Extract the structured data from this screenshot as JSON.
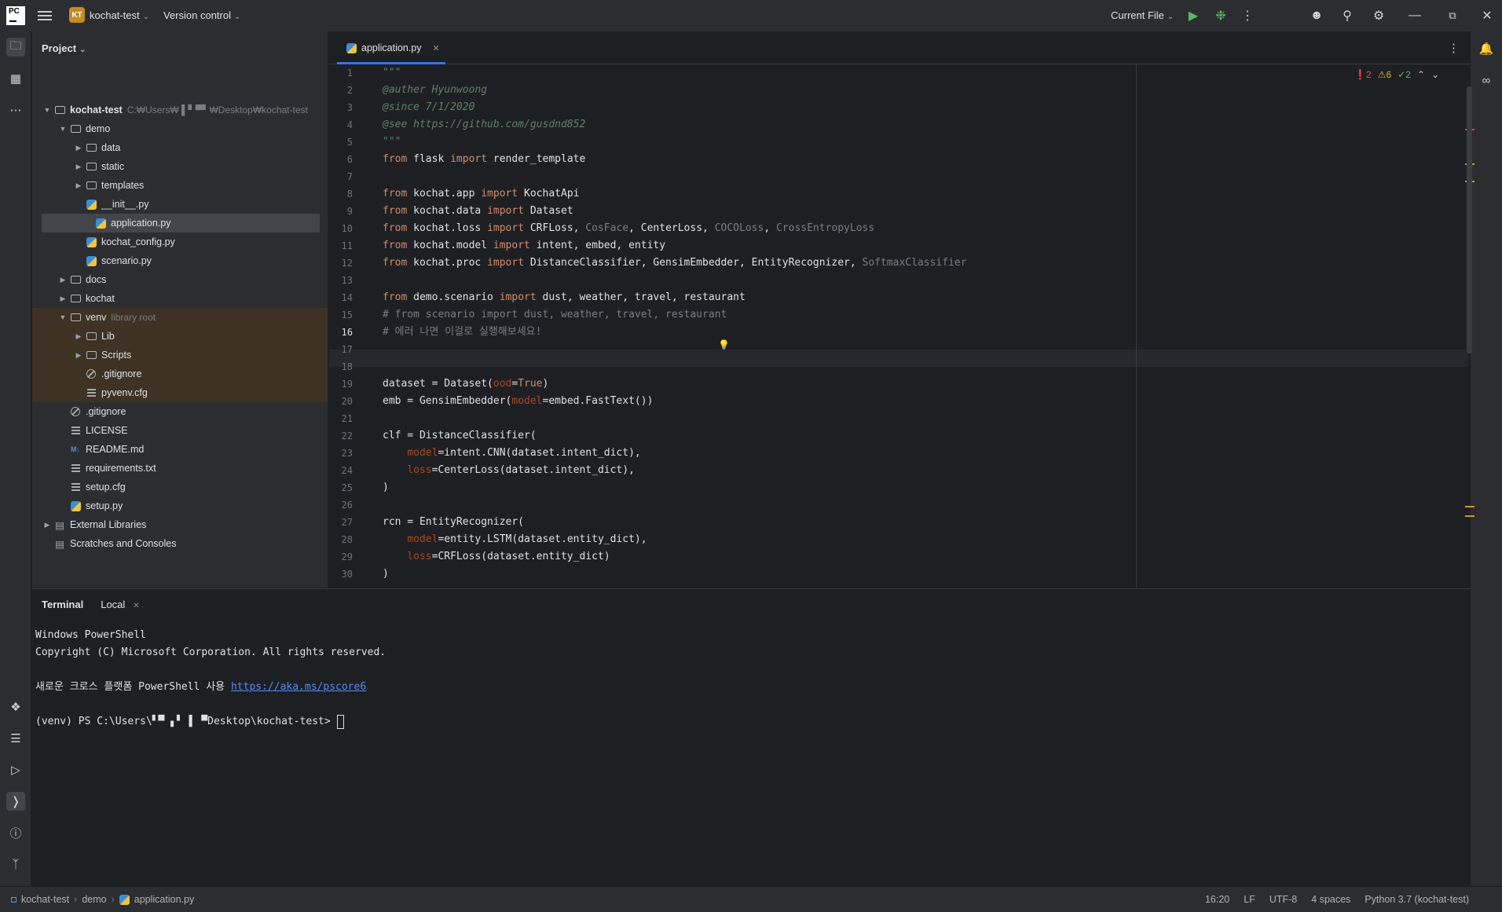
{
  "titlebar": {
    "logo": "PC",
    "project_badge": "KT",
    "project_name": "kochat-test",
    "vcs": "Version control",
    "run_config": "Current File"
  },
  "project_panel": {
    "title": "Project",
    "tree": [
      {
        "label": "kochat-test",
        "suffix": "C:₩Users₩   ▌▘▀▘₩Desktop₩kochat-test"
      },
      {
        "label": "demo"
      },
      {
        "label": "data"
      },
      {
        "label": "static"
      },
      {
        "label": "templates"
      },
      {
        "label": "__init__.py"
      },
      {
        "label": "application.py"
      },
      {
        "label": "kochat_config.py"
      },
      {
        "label": "scenario.py"
      },
      {
        "label": "docs"
      },
      {
        "label": "kochat"
      },
      {
        "label": "venv",
        "suffix": "library root"
      },
      {
        "label": "Lib"
      },
      {
        "label": "Scripts"
      },
      {
        "label": ".gitignore"
      },
      {
        "label": "pyvenv.cfg"
      },
      {
        "label": ".gitignore"
      },
      {
        "label": "LICENSE"
      },
      {
        "label": "README.md",
        "icon_text": "M↓"
      },
      {
        "label": "requirements.txt"
      },
      {
        "label": "setup.cfg"
      },
      {
        "label": "setup.py"
      },
      {
        "label": "External Libraries"
      },
      {
        "label": "Scratches and Consoles"
      }
    ]
  },
  "editor": {
    "tab": "application.py",
    "inspections": {
      "errors": "2",
      "warnings": "6",
      "ok": "2"
    },
    "line_numbers": [
      "1",
      "2",
      "3",
      "4",
      "5",
      "6",
      "7",
      "8",
      "9",
      "10",
      "11",
      "12",
      "13",
      "14",
      "15",
      "16",
      "17",
      "18",
      "19",
      "20",
      "21",
      "22",
      "23",
      "24",
      "25",
      "26",
      "27",
      "28",
      "29",
      "30"
    ],
    "lines": [
      "\"\"\"",
      "@auther Hyunwoong",
      "@since 7/1/2020",
      "@see https://github.com/gusdnd852",
      "\"\"\"",
      "from flask import render_template",
      "",
      "from kochat.app import KochatApi",
      "from kochat.data import Dataset",
      "from kochat.loss import CRFLoss, CosFace, CenterLoss, COCOLoss, CrossEntropyLoss",
      "from kochat.model import intent, embed, entity",
      "from kochat.proc import DistanceClassifier, GensimEmbedder, EntityRecognizer, SoftmaxClassifier",
      "",
      "from demo.scenario import dust, weather, travel, restaurant",
      "# from scenario import dust, weather, travel, restaurant",
      "# 에러 나면 이걸로 실행해보세요!",
      "",
      "",
      "dataset = Dataset(ood=True)",
      "emb = GensimEmbedder(model=embed.FastText())",
      "",
      "clf = DistanceClassifier(",
      "    model=intent.CNN(dataset.intent_dict),",
      "    loss=CenterLoss(dataset.intent_dict),",
      ")",
      "",
      "rcn = EntityRecognizer(",
      "    model=entity.LSTM(dataset.entity_dict),",
      "    loss=CRFLoss(dataset.entity_dict)",
      ")"
    ]
  },
  "terminal": {
    "title": "Terminal",
    "tab": "Local",
    "lines": [
      "Windows PowerShell",
      "Copyright (C) Microsoft Corporation. All rights reserved.",
      "",
      "새로운 크로스 플랫폼 PowerShell 사용 ",
      "",
      "(venv) PS C:\\Users\\▘▀ ▖▘ ▌ ▀Desktop\\kochat-test> "
    ],
    "link": "https://aka.ms/pscore6"
  },
  "statusbar": {
    "breadcrumb": [
      "kochat-test",
      "demo",
      "application.py"
    ],
    "position": "16:20",
    "line_sep": "LF",
    "encoding": "UTF-8",
    "indent": "4 spaces",
    "interpreter": "Python 3.7 (kochat-test)"
  },
  "colors": {
    "accent": "#3574f0",
    "keyword": "#cf8e6d",
    "docstring": "#5f826b",
    "param": "#aa4926",
    "link": "#548af7"
  }
}
